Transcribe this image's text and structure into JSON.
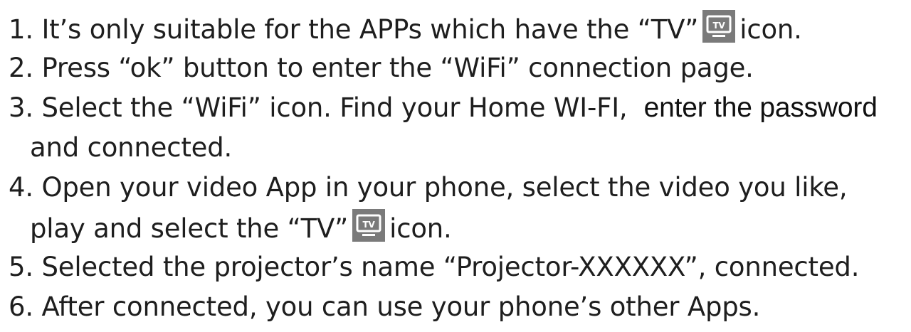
{
  "steps": [
    {
      "num": "1. ",
      "text_before": "It’s only suitable for the APPs which have the “TV”",
      "text_after": "icon."
    },
    {
      "num": "2. ",
      "text": "Press “ok” button to enter the “WiFi” connection page."
    },
    {
      "num": "3. ",
      "text": "Select the “WiFi” icon. Find your Home WI-FI,",
      "text_tail": "enter the password",
      "text_cont": "and connected."
    },
    {
      "num": "4. ",
      "text": "Open your video App in your phone, select the video you like,",
      "text_cont_before": "play and select the “TV”",
      "text_cont_after": "icon."
    },
    {
      "num": "5. ",
      "text": "Selected the projector’s name “Projector-XXXXXX”, connected."
    },
    {
      "num": "6. ",
      "text": "After connected, you can use your phone’s other Apps."
    }
  ],
  "tv_icon": {
    "label": "TV",
    "bg_color": "#7a7a7a",
    "fg_color": "#ffffff",
    "name": "tv-icon"
  }
}
